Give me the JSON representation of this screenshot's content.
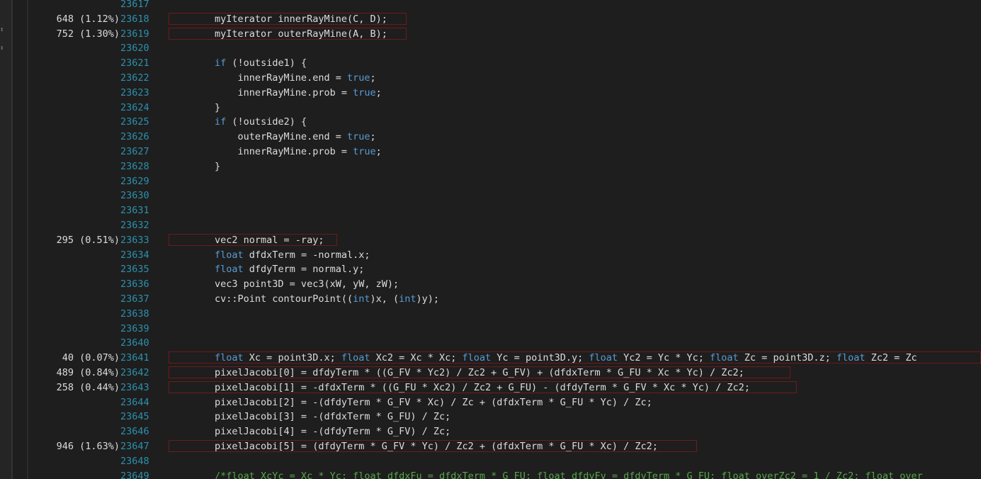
{
  "editor": {
    "lines": [
      {
        "num": "23617",
        "sample": "",
        "code": [],
        "hl": 0
      },
      {
        "num": "23618",
        "sample": "648 (1.12%)",
        "code": [
          {
            "t": "        myIterator innerRayMine(C, D);",
            "c": ""
          }
        ],
        "hl": 336
      },
      {
        "num": "23619",
        "sample": "752 (1.30%)",
        "code": [
          {
            "t": "        myIterator outerRayMine(A, B);",
            "c": ""
          }
        ],
        "hl": 336
      },
      {
        "num": "23620",
        "sample": "",
        "code": [],
        "hl": 0
      },
      {
        "num": "23621",
        "sample": "",
        "code": [
          {
            "t": "        ",
            "c": ""
          },
          {
            "t": "if",
            "c": "kw"
          },
          {
            "t": " (!outside1) {",
            "c": ""
          }
        ],
        "hl": 0
      },
      {
        "num": "23622",
        "sample": "",
        "code": [
          {
            "t": "            innerRayMine.end = ",
            "c": ""
          },
          {
            "t": "true",
            "c": "kw"
          },
          {
            "t": ";",
            "c": ""
          }
        ],
        "hl": 0
      },
      {
        "num": "23623",
        "sample": "",
        "code": [
          {
            "t": "            innerRayMine.prob = ",
            "c": ""
          },
          {
            "t": "true",
            "c": "kw"
          },
          {
            "t": ";",
            "c": ""
          }
        ],
        "hl": 0
      },
      {
        "num": "23624",
        "sample": "",
        "code": [
          {
            "t": "        }",
            "c": ""
          }
        ],
        "hl": 0
      },
      {
        "num": "23625",
        "sample": "",
        "code": [
          {
            "t": "        ",
            "c": ""
          },
          {
            "t": "if",
            "c": "kw"
          },
          {
            "t": " (!outside2) {",
            "c": ""
          }
        ],
        "hl": 0
      },
      {
        "num": "23626",
        "sample": "",
        "code": [
          {
            "t": "            outerRayMine.end = ",
            "c": ""
          },
          {
            "t": "true",
            "c": "kw"
          },
          {
            "t": ";",
            "c": ""
          }
        ],
        "hl": 0
      },
      {
        "num": "23627",
        "sample": "",
        "code": [
          {
            "t": "            innerRayMine.prob = ",
            "c": ""
          },
          {
            "t": "true",
            "c": "kw"
          },
          {
            "t": ";",
            "c": ""
          }
        ],
        "hl": 0
      },
      {
        "num": "23628",
        "sample": "",
        "code": [
          {
            "t": "        }",
            "c": ""
          }
        ],
        "hl": 0
      },
      {
        "num": "23629",
        "sample": "",
        "code": [],
        "hl": 0
      },
      {
        "num": "23630",
        "sample": "",
        "code": [],
        "hl": 0
      },
      {
        "num": "23631",
        "sample": "",
        "code": [],
        "hl": 0
      },
      {
        "num": "23632",
        "sample": "",
        "code": [],
        "hl": 0
      },
      {
        "num": "23633",
        "sample": "295 (0.51%)",
        "code": [
          {
            "t": "        vec2 normal = -ray;",
            "c": ""
          }
        ],
        "hl": 238
      },
      {
        "num": "23634",
        "sample": "",
        "code": [
          {
            "t": "        ",
            "c": ""
          },
          {
            "t": "float",
            "c": "kw"
          },
          {
            "t": " dfdxTerm = -normal.x;",
            "c": ""
          }
        ],
        "hl": 0
      },
      {
        "num": "23635",
        "sample": "",
        "code": [
          {
            "t": "        ",
            "c": ""
          },
          {
            "t": "float",
            "c": "kw"
          },
          {
            "t": " dfdyTerm = normal.y;",
            "c": ""
          }
        ],
        "hl": 0
      },
      {
        "num": "23636",
        "sample": "",
        "code": [
          {
            "t": "        vec3 point3D = vec3(xW, yW, zW);",
            "c": ""
          }
        ],
        "hl": 0
      },
      {
        "num": "23637",
        "sample": "",
        "code": [
          {
            "t": "        cv::Point contourPoint((",
            "c": ""
          },
          {
            "t": "int",
            "c": "kw"
          },
          {
            "t": ")x, (",
            "c": ""
          },
          {
            "t": "int",
            "c": "kw"
          },
          {
            "t": ")y);",
            "c": ""
          }
        ],
        "hl": 0
      },
      {
        "num": "23638",
        "sample": "",
        "code": [],
        "hl": 0
      },
      {
        "num": "23639",
        "sample": "",
        "code": [],
        "hl": 0
      },
      {
        "num": "23640",
        "sample": "",
        "code": [],
        "hl": 0
      },
      {
        "num": "23641",
        "sample": "40 (0.07%)",
        "code": [
          {
            "t": "        ",
            "c": ""
          },
          {
            "t": "float",
            "c": "kw"
          },
          {
            "t": " Xc = point3D.x; ",
            "c": ""
          },
          {
            "t": "float",
            "c": "kw"
          },
          {
            "t": " Xc2 = Xc * Xc; ",
            "c": ""
          },
          {
            "t": "float",
            "c": "kw"
          },
          {
            "t": " Yc = point3D.y; ",
            "c": ""
          },
          {
            "t": "float",
            "c": "kw"
          },
          {
            "t": " Yc2 = Yc * Yc; ",
            "c": ""
          },
          {
            "t": "float",
            "c": "kw"
          },
          {
            "t": " Zc = point3D.z; ",
            "c": ""
          },
          {
            "t": "float",
            "c": "kw"
          },
          {
            "t": " Zc2 = Zc",
            "c": ""
          }
        ],
        "hl": 1147
      },
      {
        "num": "23642",
        "sample": "489 (0.84%)",
        "code": [
          {
            "t": "        pixelJacobi[0] = dfdyTerm * ((G_FV * Yc2) / Zc2 + G_FV) + (dfdxTerm * G_FU * Xc * Yc) / Zc2;",
            "c": ""
          }
        ],
        "hl": 878
      },
      {
        "num": "23643",
        "sample": "258 (0.44%)",
        "code": [
          {
            "t": "        pixelJacobi[1] = -dfdxTerm * ((G_FU * Xc2) / Zc2 + G_FU) - (dfdyTerm * G_FV * Xc * Yc) / Zc2;",
            "c": ""
          }
        ],
        "hl": 887
      },
      {
        "num": "23644",
        "sample": "",
        "code": [
          {
            "t": "        pixelJacobi[2] = -(dfdyTerm * G_FV * Xc) / Zc + (dfdxTerm * G_FU * Yc) / Zc;",
            "c": ""
          }
        ],
        "hl": 0
      },
      {
        "num": "23645",
        "sample": "",
        "code": [
          {
            "t": "        pixelJacobi[3] = -(dfdxTerm * G_FU) / Zc;",
            "c": ""
          }
        ],
        "hl": 0
      },
      {
        "num": "23646",
        "sample": "",
        "code": [
          {
            "t": "        pixelJacobi[4] = -(dfdyTerm * G_FV) / Zc;",
            "c": ""
          }
        ],
        "hl": 0
      },
      {
        "num": "23647",
        "sample": "946 (1.63%)",
        "code": [
          {
            "t": "        pixelJacobi[5] = (dfdyTerm * G_FV * Yc) / Zc2 + (dfdxTerm * G_FU * Xc) / Zc2;",
            "c": ""
          }
        ],
        "hl": 746
      },
      {
        "num": "23648",
        "sample": "",
        "code": [],
        "hl": 0
      },
      {
        "num": "23649",
        "sample": "",
        "code": [
          {
            "t": "        /*float XcYc = Xc * Yc; float dfdxFu = dfdxTerm * G_FU; float dfdyFv = dfdyTerm * G_FU; float overZc2 = 1 / Zc2; float over",
            "c": "cm"
          }
        ],
        "hl": 0
      }
    ]
  }
}
